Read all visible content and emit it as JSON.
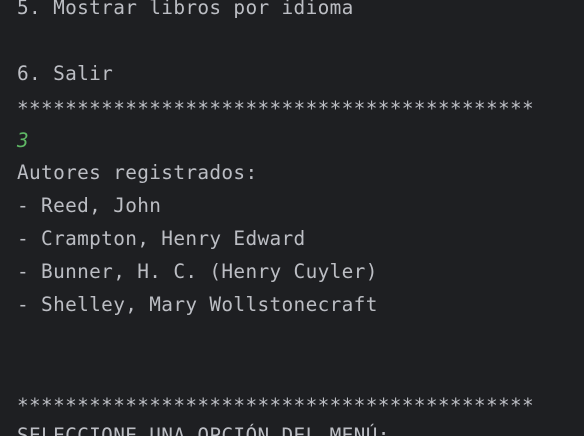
{
  "console": {
    "menu_option_5": "5. Mostrar libros por idioma",
    "menu_option_6": "6. Salir",
    "separator_top": "*******************************************",
    "user_input": "3",
    "authors_heading": "Autores registrados:",
    "authors": [
      "- Reed, John",
      "- Crampton, Henry Edward",
      "- Bunner, H. C. (Henry Cuyler)",
      "- Shelley, Mary Wollstonecraft"
    ],
    "separator_bottom": "*******************************************",
    "prompt_partial": "SELECCIONE UNA OPCIÓN DEL MENÚ:"
  },
  "colors": {
    "background": "#1e1f22",
    "text": "#bcbec4",
    "input": "#5fb865"
  }
}
